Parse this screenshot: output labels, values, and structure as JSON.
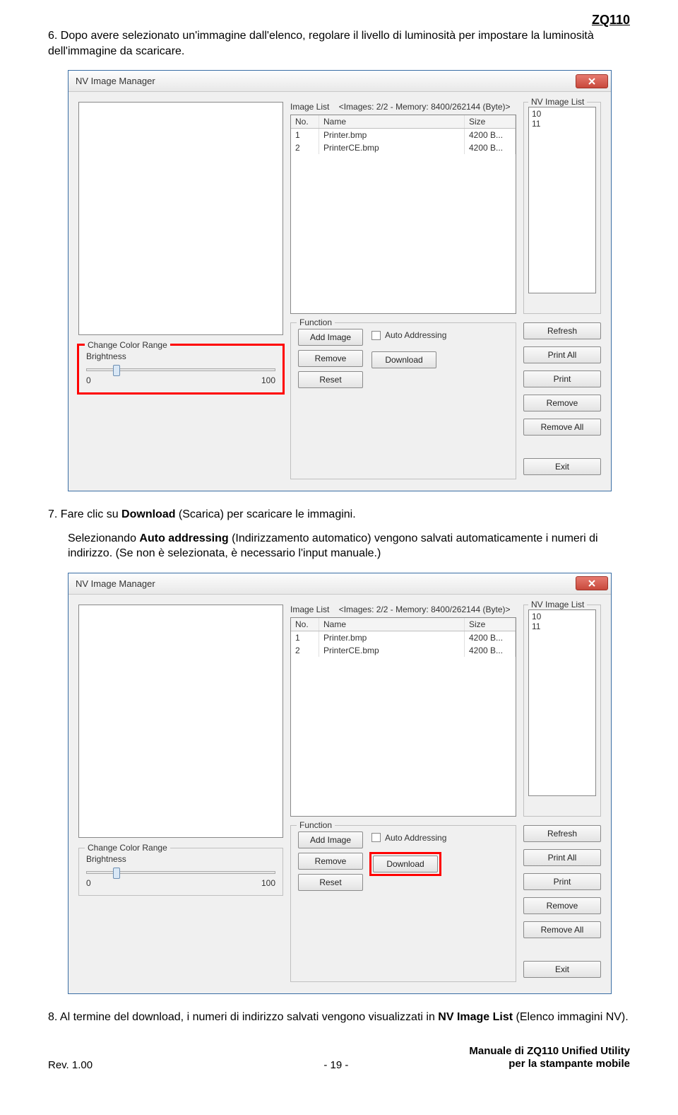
{
  "doc": {
    "header": "ZQ110",
    "step6_num": "6.",
    "step6_text": "Dopo avere selezionato un'immagine dall'elenco, regolare il livello di luminosità per impostare la luminosità dell'immagine da scaricare.",
    "step7_num": "7.",
    "step7_a": "Fare clic su ",
    "step7_bold": "Download",
    "step7_b": " (Scarica) per scaricare le immagini.",
    "step7_p2a": "Selezionando ",
    "step7_p2bold": "Auto addressing",
    "step7_p2b": " (Indirizzamento automatico) vengono salvati automaticamente i numeri di indirizzo. (Se non è selezionata, è necessario l'input manuale.)",
    "step8_num": "8.",
    "step8_a": "Al termine del download, i numeri di indirizzo salvati vengono visualizzati in ",
    "step8_bold": "NV Image List",
    "step8_b": " (Elenco immagini NV)."
  },
  "dialog": {
    "title": "NV Image Manager",
    "imageListLabel": "Image List",
    "imageListMeta": "<Images: 2/2 - Memory: 8400/262144 (Byte)>",
    "headers": {
      "no": "No.",
      "name": "Name",
      "size": "Size"
    },
    "rows": [
      {
        "no": "1",
        "name": "Printer.bmp",
        "size": "4200 B..."
      },
      {
        "no": "2",
        "name": "PrinterCE.bmp",
        "size": "4200 B..."
      }
    ],
    "nvLegend": "NV Image List",
    "nvItems": [
      "10",
      "11"
    ],
    "colorLegend": "Change Color Range",
    "brightness": "Brightness",
    "sliderMin": "0",
    "sliderMax": "100",
    "funcLegend": "Function",
    "buttons": {
      "addImage": "Add Image",
      "remove": "Remove",
      "reset": "Reset",
      "autoAddr": "Auto Addressing",
      "download": "Download",
      "refresh": "Refresh",
      "printAll": "Print All",
      "print": "Print",
      "removeR": "Remove",
      "removeAll": "Remove All",
      "exit": "Exit"
    }
  },
  "footer": {
    "rev": "Rev.  1.00",
    "page": "-  19  -",
    "title1": "Manuale di ZQ110 Unified Utility",
    "title2": "per la stampante mobile"
  }
}
